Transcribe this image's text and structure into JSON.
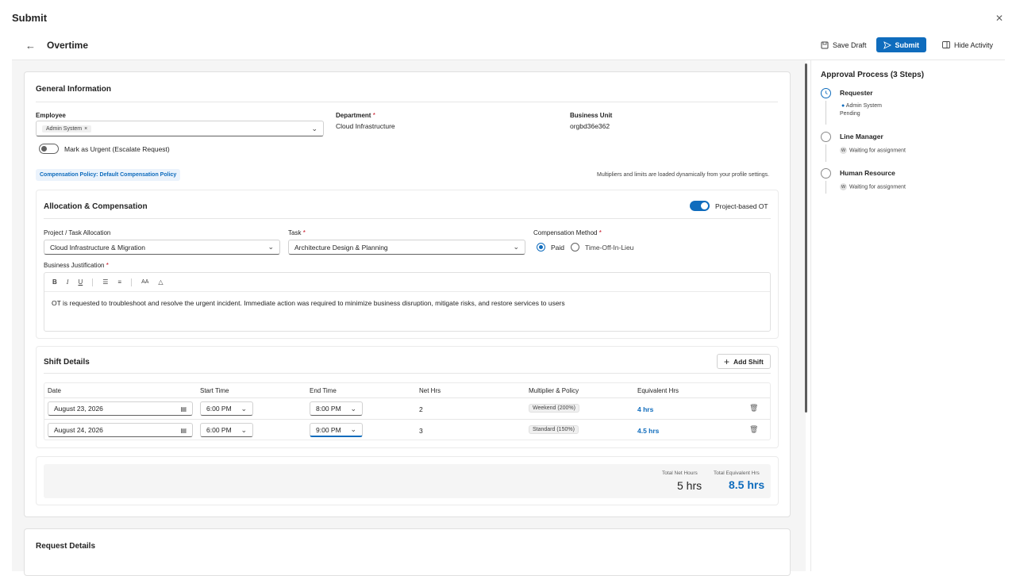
{
  "app": {
    "title": "Submit"
  },
  "header": {
    "title": "Overtime",
    "save_draft": "Save Draft",
    "submit": "Submit",
    "hide_activity": "Hide Activity"
  },
  "general": {
    "title": "General Information",
    "employee_label": "Employee",
    "employee_chip": "Admin System",
    "department_label": "Department",
    "department_value": "Cloud Infrastructure",
    "bu_label": "Business Unit",
    "bu_value": "orgbd36e362",
    "urgent_label": "Mark as Urgent (Escalate Request)",
    "policy_badge": "Compensation Policy: Default Compensation Policy",
    "policy_note": "Multipliers and limits are loaded dynamically from your profile settings."
  },
  "allocation": {
    "title": "Allocation & Compensation",
    "project_ot_label": "Project-based OT",
    "project_label": "Project / Task Allocation",
    "project_value": "Cloud Infrastructure & Migration",
    "task_label": "Task",
    "task_value": "Architecture Design & Planning",
    "comp_label": "Compensation Method",
    "comp_paid": "Paid",
    "comp_toil": "Time-Off-In-Lieu",
    "justification_label": "Business Justification",
    "justification_text": "OT is requested to troubleshoot and resolve the urgent  incident. Immediate action was required to minimize business disruption, mitigate risks, and restore services to users"
  },
  "shifts": {
    "title": "Shift Details",
    "add_shift": "Add Shift",
    "columns": [
      "Date",
      "Start Time",
      "End Time",
      "Net Hrs",
      "Multiplier & Policy",
      "Equivalent Hrs"
    ],
    "rows": [
      {
        "date": "August 23, 2026",
        "start": "6:00 PM",
        "end": "8:00 PM",
        "net": "2",
        "policy": "Weekend (200%)",
        "equiv": "4 hrs"
      },
      {
        "date": "August 24, 2026",
        "start": "6:00 PM",
        "end": "9:00 PM",
        "net": "3",
        "policy": "Standard (150%)",
        "equiv": "4.5 hrs"
      }
    ]
  },
  "summary": {
    "net_label": "Total Net Hours",
    "net_value": "5 hrs",
    "equiv_label": "Total Equivalent Hrs",
    "equiv_value": "8.5 hrs"
  },
  "request": {
    "title": "Request Details"
  },
  "approval": {
    "title": "Approval Process (3 Steps)",
    "steps": [
      {
        "name": "Requester",
        "person": "Admin System",
        "status": "Pending"
      },
      {
        "name": "Line Manager",
        "status": "Waiting for assignment"
      },
      {
        "name": "Human Resource",
        "status": "Waiting for assignment"
      }
    ]
  },
  "colors": {
    "accent": "#0f6cbd",
    "danger": "#c50f1f"
  }
}
